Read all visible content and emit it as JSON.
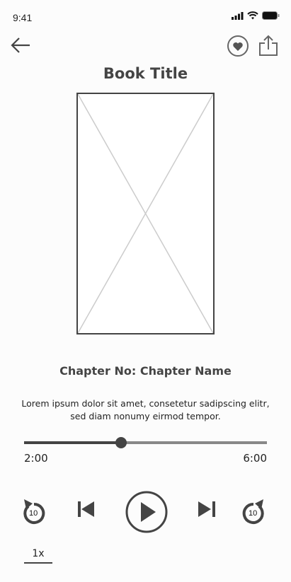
{
  "status_bar": {
    "time": "9:41"
  },
  "header": {
    "title": "Book Title"
  },
  "chapter": {
    "title": "Chapter No: Chapter Name",
    "description": "Lorem ipsum dolor sit amet, consetetur sadipscing elitr, sed diam nonumy eirmod tempor."
  },
  "player": {
    "elapsed": "2:00",
    "total": "6:00",
    "progress": 0.4,
    "rewind_seconds": "10",
    "forward_seconds": "10",
    "speed": "1x"
  }
}
